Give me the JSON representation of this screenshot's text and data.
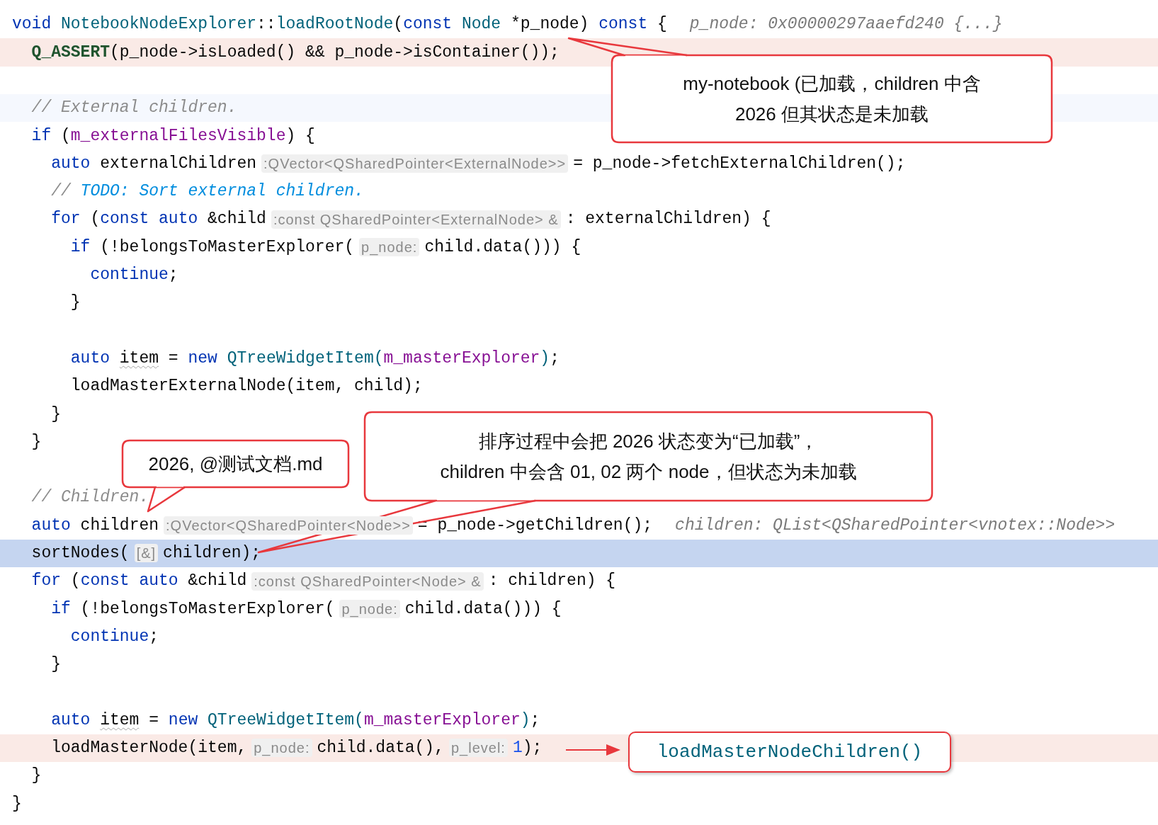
{
  "editor": {
    "lines": [
      {
        "parts": [
          {
            "kind": "code",
            "tokens": [
              {
                "kind": "keyword",
                "text": "void "
              },
              {
                "kind": "type",
                "text": "NotebookNodeExplorer"
              },
              {
                "kind": "plain",
                "text": "::"
              },
              {
                "kind": "function",
                "text": "loadRootNode"
              },
              {
                "kind": "plain",
                "text": "("
              },
              {
                "kind": "keyword",
                "text": "const "
              },
              {
                "kind": "type",
                "text": "Node"
              },
              {
                "kind": "plain",
                "text": " *p_node) "
              },
              {
                "kind": "keyword",
                "text": "const"
              },
              {
                "kind": "plain",
                "text": " {"
              }
            ]
          },
          {
            "kind": "debug",
            "text": "p_node: 0x00000297aaefd240 {...}"
          }
        ],
        "children": [
          {
            "kind": "marked",
            "parts": [
              {
                "kind": "code",
                "tokens": [
                  {
                    "kind": "macro",
                    "text": "Q_ASSERT"
                  },
                  {
                    "kind": "plain",
                    "text": "(p_node->isLoaded() && p_node->isContainer());"
                  }
                ]
              }
            ]
          },
          {
            "kind": "tinted",
            "blank_line_before": true,
            "parts": [
              {
                "kind": "code",
                "tokens": [
                  {
                    "kind": "comment",
                    "text": "// External children."
                  }
                ]
              }
            ]
          },
          {
            "parts": [
              {
                "kind": "code",
                "tokens": [
                  {
                    "kind": "keyword",
                    "text": "if"
                  },
                  {
                    "kind": "plain",
                    "text": " ("
                  },
                  {
                    "kind": "field",
                    "text": "m_externalFilesVisible"
                  },
                  {
                    "kind": "plain",
                    "text": ") {"
                  }
                ]
              }
            ],
            "children": [
              {
                "parts": [
                  {
                    "kind": "code",
                    "tokens": [
                      {
                        "kind": "keyword",
                        "text": "auto"
                      },
                      {
                        "kind": "plain",
                        "text": " externalChildren"
                      }
                    ]
                  },
                  {
                    "kind": "hint",
                    "text": ":QVector<QSharedPointer<ExternalNode>>"
                  },
                  {
                    "kind": "code",
                    "tokens": [
                      {
                        "kind": "plain",
                        "text": "= p_node->fetchExternalChildren();"
                      }
                    ]
                  }
                ]
              },
              {
                "parts": [
                  {
                    "kind": "code",
                    "tokens": [
                      {
                        "kind": "comment",
                        "text": "// "
                      },
                      {
                        "kind": "todo",
                        "text": "TODO: Sort external children."
                      }
                    ]
                  }
                ]
              },
              {
                "parts": [
                  {
                    "kind": "code",
                    "tokens": [
                      {
                        "kind": "keyword",
                        "text": "for"
                      },
                      {
                        "kind": "plain",
                        "text": " ("
                      },
                      {
                        "kind": "keyword",
                        "text": "const auto"
                      },
                      {
                        "kind": "plain",
                        "text": " &child"
                      }
                    ]
                  },
                  {
                    "kind": "hint",
                    "text": ":const QSharedPointer<ExternalNode> &"
                  },
                  {
                    "kind": "code",
                    "tokens": [
                      {
                        "kind": "plain",
                        "text": ": externalChildren) {"
                      }
                    ]
                  }
                ],
                "children": [
                  {
                    "parts": [
                      {
                        "kind": "code",
                        "tokens": [
                          {
                            "kind": "keyword",
                            "text": "if"
                          },
                          {
                            "kind": "plain",
                            "text": " (!belongsToMasterExplorer("
                          }
                        ]
                      },
                      {
                        "kind": "hint",
                        "text": "p_node:"
                      },
                      {
                        "kind": "code",
                        "tokens": [
                          {
                            "kind": "plain",
                            "text": "child.data())) {"
                          }
                        ]
                      }
                    ],
                    "children": [
                      {
                        "parts": [
                          {
                            "kind": "code",
                            "tokens": [
                              {
                                "kind": "keyword",
                                "text": "continue"
                              },
                              {
                                "kind": "plain",
                                "text": ";"
                              }
                            ]
                          }
                        ]
                      }
                    ]
                  },
                  {
                    "parts": [
                      {
                        "kind": "code",
                        "tokens": [
                          {
                            "kind": "plain",
                            "text": "}"
                          }
                        ]
                      }
                    ]
                  },
                  {
                    "blank_line_before": true,
                    "parts": [
                      {
                        "kind": "code",
                        "tokens": [
                          {
                            "kind": "keyword",
                            "text": "auto "
                          },
                          {
                            "kind": "warning",
                            "text": "item"
                          },
                          {
                            "kind": "plain",
                            "text": " = "
                          },
                          {
                            "kind": "keyword",
                            "text": "new "
                          },
                          {
                            "kind": "type",
                            "text": "QTreeWidgetItem("
                          },
                          {
                            "kind": "field",
                            "text": "m_masterExplorer"
                          },
                          {
                            "kind": "type",
                            "text": ")"
                          },
                          {
                            "kind": "plain",
                            "text": ";"
                          }
                        ]
                      }
                    ]
                  },
                  {
                    "parts": [
                      {
                        "kind": "code",
                        "tokens": [
                          {
                            "kind": "plain",
                            "text": "loadMasterExternalNode(item, child);"
                          }
                        ]
                      }
                    ]
                  }
                ]
              },
              {
                "parts": [
                  {
                    "kind": "code",
                    "tokens": [
                      {
                        "kind": "plain",
                        "text": "}"
                      }
                    ]
                  }
                ]
              }
            ]
          },
          {
            "parts": [
              {
                "kind": "code",
                "tokens": [
                  {
                    "kind": "plain",
                    "text": "}"
                  }
                ]
              }
            ]
          },
          {
            "blank_line_before": true,
            "parts": [
              {
                "kind": "code",
                "tokens": [
                  {
                    "kind": "comment",
                    "text": "// Children."
                  }
                ]
              }
            ]
          },
          {
            "parts": [
              {
                "kind": "code",
                "tokens": [
                  {
                    "kind": "keyword",
                    "text": "auto"
                  },
                  {
                    "kind": "plain",
                    "text": " children"
                  }
                ]
              },
              {
                "kind": "hint",
                "text": ":QVector<QSharedPointer<Node>>"
              },
              {
                "kind": "code",
                "tokens": [
                  {
                    "kind": "plain",
                    "text": "= p_node->getChildren();"
                  }
                ]
              },
              {
                "kind": "debug",
                "text": "children: QList<QSharedPointer<vnotex::Node>>"
              }
            ]
          },
          {
            "kind": "caret",
            "parts": [
              {
                "kind": "code",
                "tokens": [
                  {
                    "kind": "plain",
                    "text": "sortNodes("
                  }
                ]
              },
              {
                "kind": "hint",
                "text": "[&]"
              },
              {
                "kind": "code",
                "tokens": [
                  {
                    "kind": "plain",
                    "text": "children);"
                  }
                ]
              }
            ]
          },
          {
            "parts": [
              {
                "kind": "code",
                "tokens": [
                  {
                    "kind": "keyword",
                    "text": "for"
                  },
                  {
                    "kind": "plain",
                    "text": " ("
                  },
                  {
                    "kind": "keyword",
                    "text": "const auto"
                  },
                  {
                    "kind": "plain",
                    "text": " &child"
                  }
                ]
              },
              {
                "kind": "hint",
                "text": ":const QSharedPointer<Node> &"
              },
              {
                "kind": "code",
                "tokens": [
                  {
                    "kind": "plain",
                    "text": ": children) {"
                  }
                ]
              }
            ],
            "children": [
              {
                "parts": [
                  {
                    "kind": "code",
                    "tokens": [
                      {
                        "kind": "keyword",
                        "text": "if"
                      },
                      {
                        "kind": "plain",
                        "text": " (!belongsToMasterExplorer("
                      }
                    ]
                  },
                  {
                    "kind": "hint",
                    "text": "p_node:"
                  },
                  {
                    "kind": "code",
                    "tokens": [
                      {
                        "kind": "plain",
                        "text": "child.data())) {"
                      }
                    ]
                  }
                ],
                "children": [
                  {
                    "parts": [
                      {
                        "kind": "code",
                        "tokens": [
                          {
                            "kind": "keyword",
                            "text": "continue"
                          },
                          {
                            "kind": "plain",
                            "text": ";"
                          }
                        ]
                      }
                    ]
                  }
                ]
              },
              {
                "parts": [
                  {
                    "kind": "code",
                    "tokens": [
                      {
                        "kind": "plain",
                        "text": "}"
                      }
                    ]
                  }
                ]
              },
              {
                "blank_line_before": true,
                "parts": [
                  {
                    "kind": "code",
                    "tokens": [
                      {
                        "kind": "keyword",
                        "text": "auto "
                      },
                      {
                        "kind": "warning",
                        "text": "item"
                      },
                      {
                        "kind": "plain",
                        "text": " = "
                      },
                      {
                        "kind": "keyword",
                        "text": "new "
                      },
                      {
                        "kind": "type",
                        "text": "QTreeWidgetItem("
                      },
                      {
                        "kind": "field",
                        "text": "m_masterExplorer"
                      },
                      {
                        "kind": "type",
                        "text": ")"
                      },
                      {
                        "kind": "plain",
                        "text": ";"
                      }
                    ]
                  }
                ]
              },
              {
                "kind": "marked",
                "parts": [
                  {
                    "kind": "code",
                    "tokens": [
                      {
                        "kind": "plain",
                        "text": "loadMasterNode(item,"
                      }
                    ]
                  },
                  {
                    "kind": "hint",
                    "text": "p_node:"
                  },
                  {
                    "kind": "code",
                    "tokens": [
                      {
                        "kind": "plain",
                        "text": "child.data(),"
                      }
                    ]
                  },
                  {
                    "kind": "hint",
                    "text": "p_level:"
                  },
                  {
                    "kind": "code",
                    "tokens": [
                      {
                        "kind": "number",
                        "text": "1"
                      },
                      {
                        "kind": "plain",
                        "text": ");"
                      }
                    ]
                  }
                ]
              }
            ]
          },
          {
            "parts": [
              {
                "kind": "code",
                "tokens": [
                  {
                    "kind": "plain",
                    "text": "}"
                  }
                ]
              }
            ]
          }
        ]
      },
      {
        "parts": [
          {
            "kind": "code",
            "tokens": [
              {
                "kind": "plain",
                "text": "}"
              }
            ]
          }
        ]
      }
    ]
  },
  "callouts": [
    {
      "kind": "bubble",
      "lines": [
        "my-notebook (已加载，children 中含",
        "2026 但其状态是未加载"
      ]
    },
    {
      "kind": "bubble",
      "lines": [
        "2026, @测试文档.md"
      ]
    },
    {
      "kind": "bubble",
      "lines": [
        "排序过程中会把 2026 状态变为“已加载”，",
        "children 中会含 01, 02 两个 node，但状态为未加载"
      ]
    },
    {
      "kind": "arrow-box",
      "lines": [
        "loadMasterNodeChildren()"
      ]
    }
  ]
}
